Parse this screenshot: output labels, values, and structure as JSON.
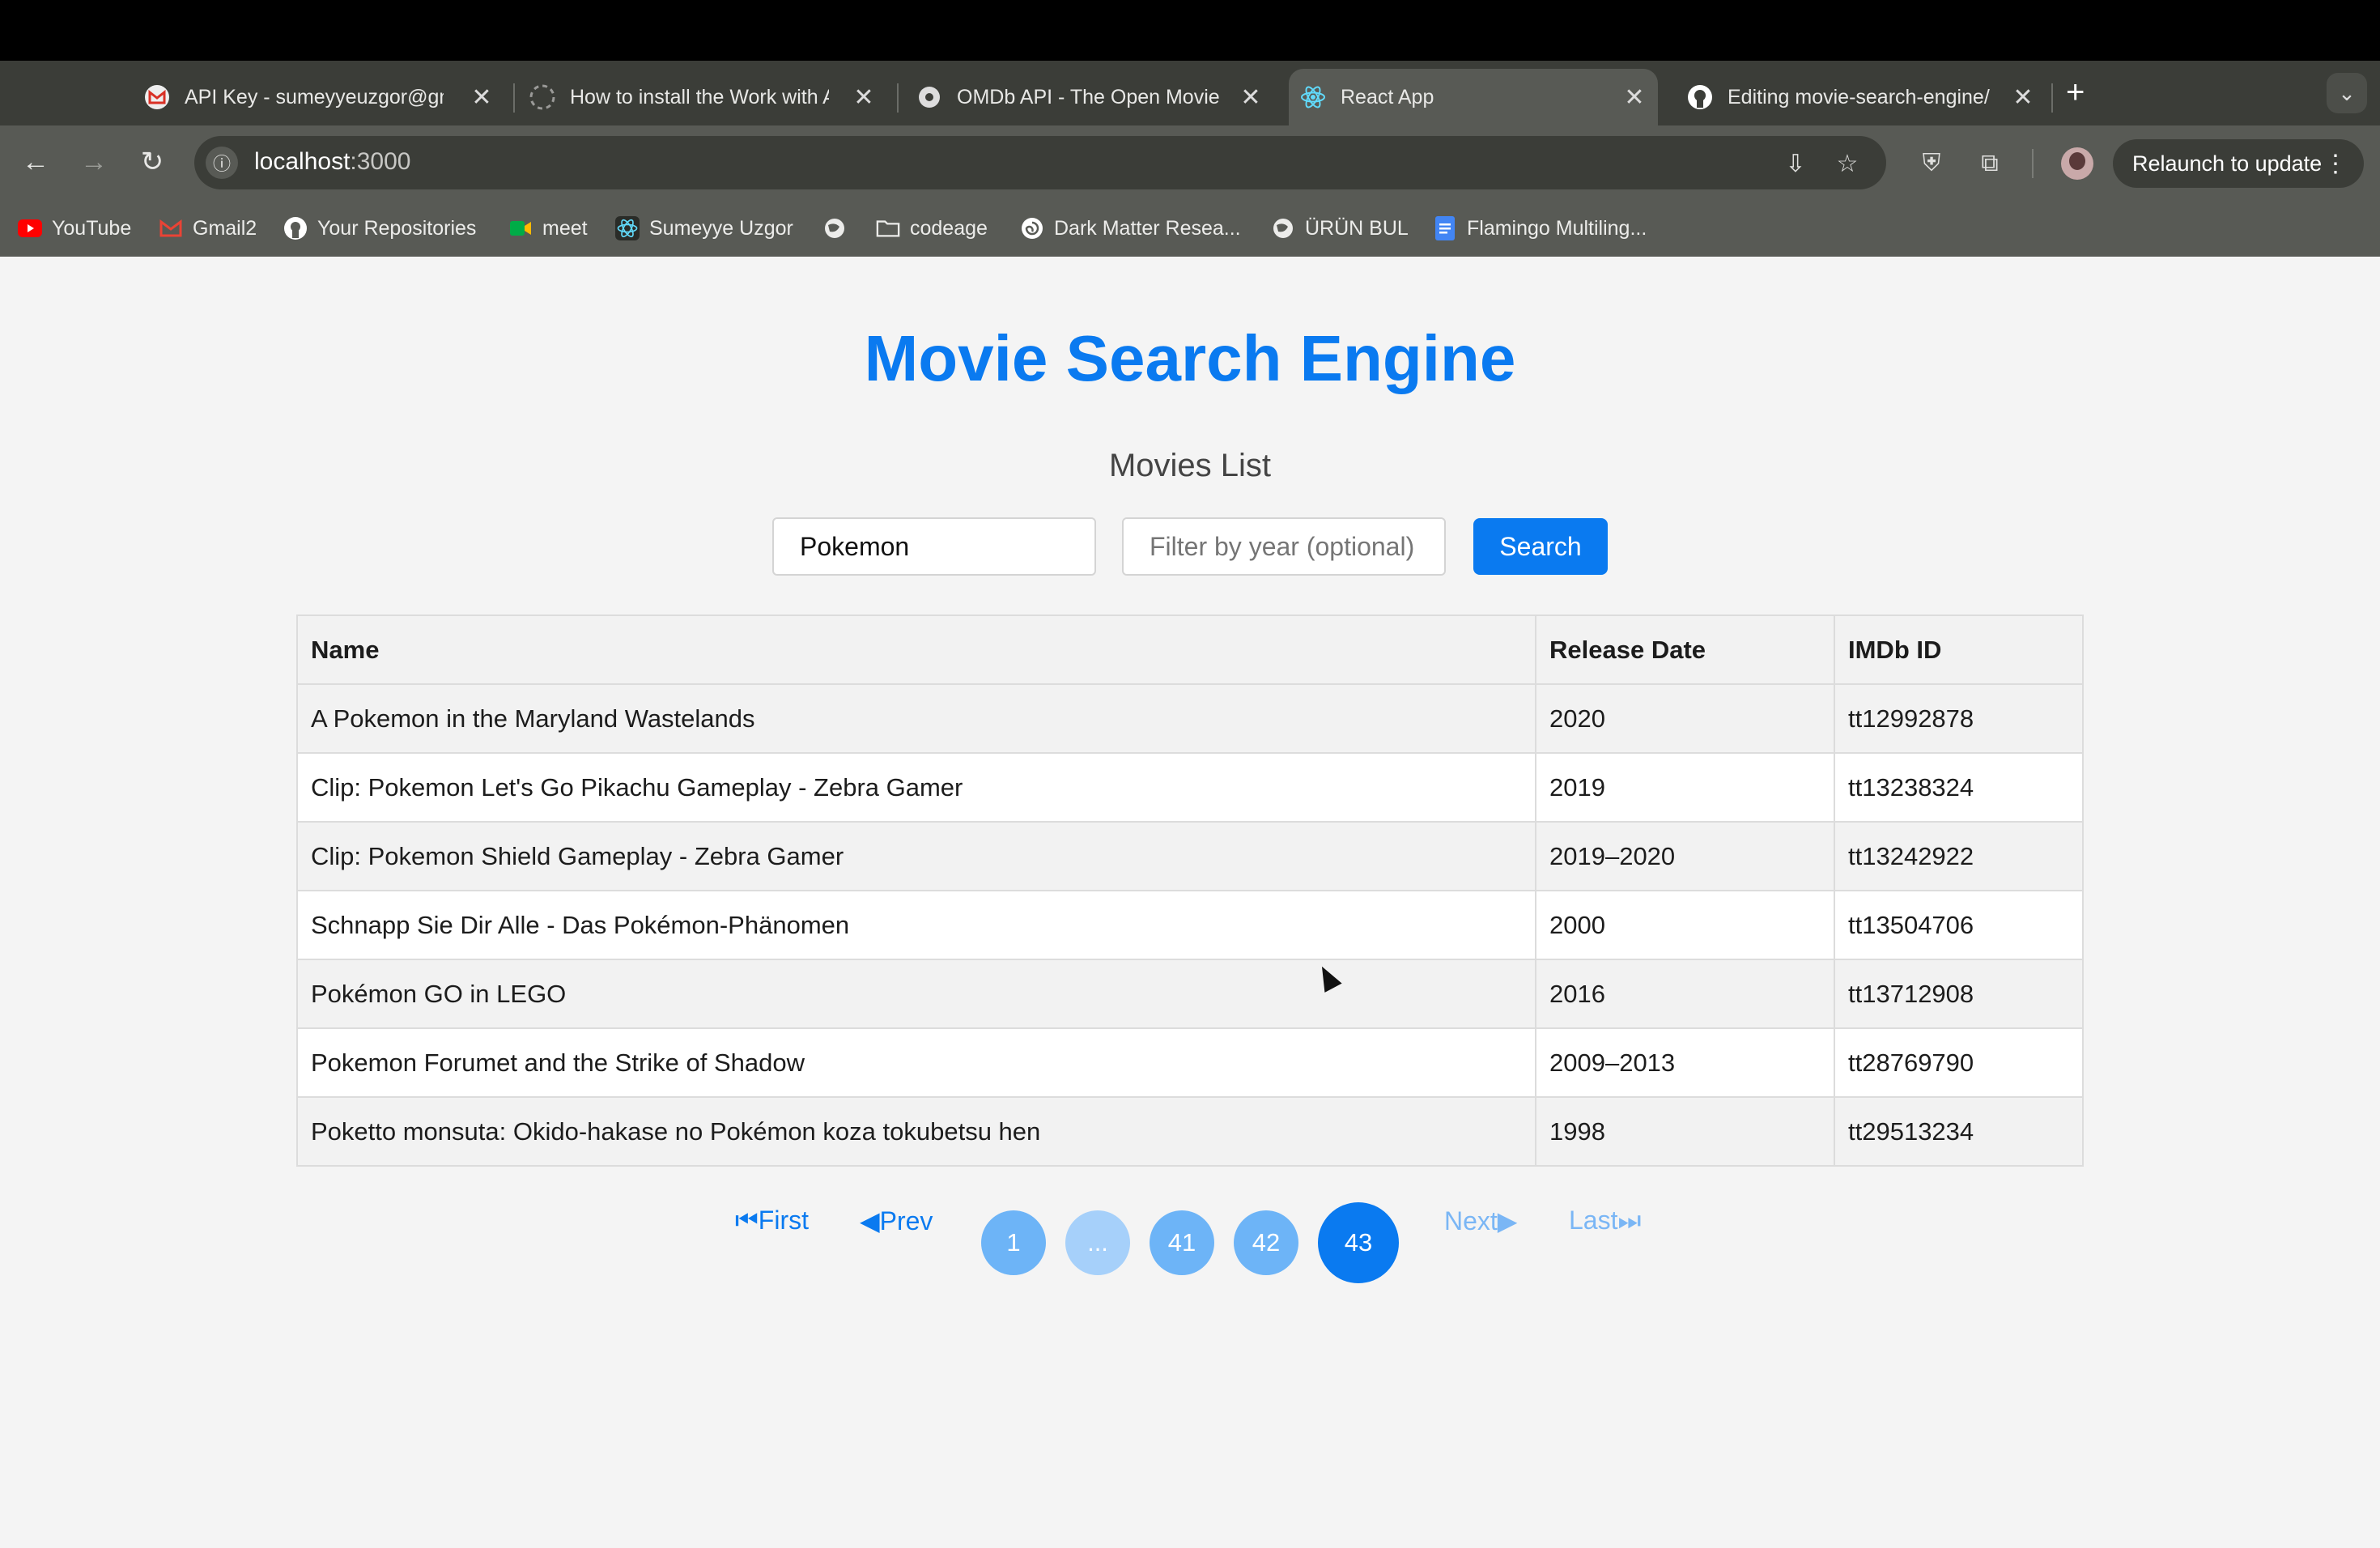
{
  "browser": {
    "tabs": [
      {
        "title": "API Key - sumeyyeuzgor@gmail.com",
        "icon": "gmail-icon"
      },
      {
        "title": "How to install the Work with Azure",
        "icon": "loading-icon"
      },
      {
        "title": "OMDb API - The Open Movie Database",
        "icon": "omdb-icon"
      },
      {
        "title": "React App",
        "icon": "react-icon",
        "active": true
      },
      {
        "title": "Editing movie-search-engine/",
        "icon": "github-icon"
      }
    ],
    "new_tab": "+",
    "tab_menu": "⌄",
    "url_host": "localhost",
    "url_port": ":3000",
    "relaunch_label": "Relaunch to update",
    "bookmarks": [
      {
        "label": "YouTube",
        "icon": "youtube-icon"
      },
      {
        "label": "Gmail2",
        "icon": "gmail-icon"
      },
      {
        "label": "Your Repositories",
        "icon": "github-icon"
      },
      {
        "label": "meet",
        "icon": "meet-icon"
      },
      {
        "label": "Sumeyye Uzgor",
        "icon": "react-icon"
      },
      {
        "label": "",
        "icon": "globe-icon"
      },
      {
        "label": "codeage",
        "icon": "folder-icon"
      },
      {
        "label": "Dark Matter Resea...",
        "icon": "spiral-icon"
      },
      {
        "label": "ÜRÜN BUL",
        "icon": "globe-icon"
      },
      {
        "label": "Flamingo Multiling...",
        "icon": "docs-icon"
      }
    ]
  },
  "app": {
    "title": "Movie Search Engine",
    "subtitle": "Movies List",
    "search_value": "Pokemon",
    "year_placeholder": "Filter by year (optional)",
    "search_button": "Search",
    "table": {
      "headers": [
        "Name",
        "Release Date",
        "IMDb ID"
      ],
      "rows": [
        [
          "A Pokemon in the Maryland Wastelands",
          "2020",
          "tt12992878"
        ],
        [
          "Clip: Pokemon Let's Go Pikachu Gameplay - Zebra Gamer",
          "2019",
          "tt13238324"
        ],
        [
          "Clip: Pokemon Shield Gameplay - Zebra Gamer",
          "2019–2020",
          "tt13242922"
        ],
        [
          "Schnapp Sie Dir Alle - Das Pokémon-Phänomen",
          "2000",
          "tt13504706"
        ],
        [
          "Pokémon GO in LEGO",
          "2016",
          "tt13712908"
        ],
        [
          "Pokemon Forumet and the Strike of Shadow",
          "2009–2013",
          "tt28769790"
        ],
        [
          "Poketto monsuta: Okido-hakase no Pokémon koza tokubetsu hen",
          "1998",
          "tt29513234"
        ]
      ]
    },
    "pagination": {
      "first": "⏮First",
      "prev": "◀Prev",
      "pages": [
        "1",
        "...",
        "41",
        "42",
        "43"
      ],
      "current": "43",
      "next": "Next▶",
      "last": "Last⏭"
    }
  },
  "colors": {
    "accent": "#0a7af0",
    "page_bg": "#f4f4f4"
  }
}
